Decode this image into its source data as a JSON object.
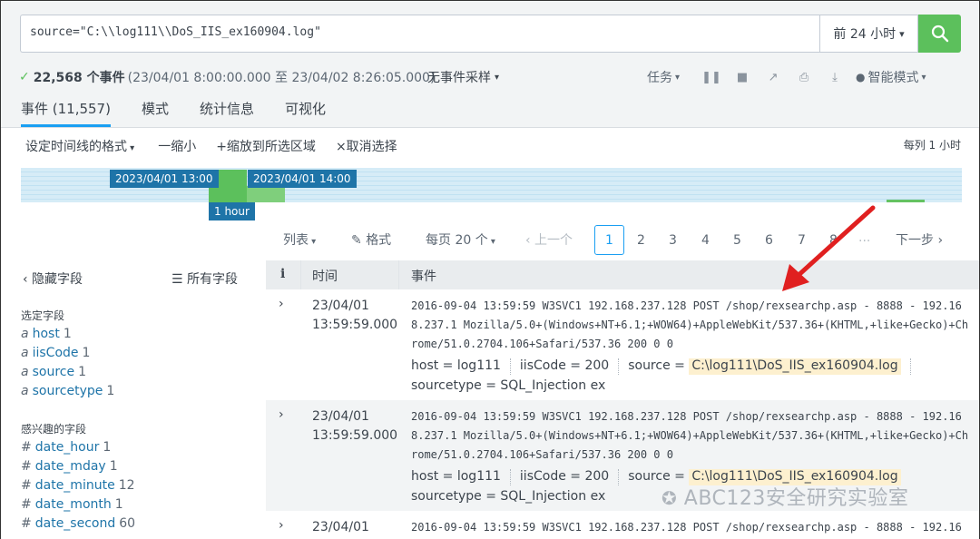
{
  "search": {
    "query": "source=\"C:\\\\log111\\\\DoS_IIS_ex160904.log\"",
    "time_range": "前 24 小时",
    "time_caret": "▾"
  },
  "status": {
    "check": "✓",
    "count": "22,568 个事件",
    "range": "(23/04/01 8:00:00.000 至 23/04/02 8:26:05.000)",
    "sampling": "无事件采样",
    "job": "任务",
    "smart_mode": "智能模式"
  },
  "tabs": [
    {
      "label": "事件 (11,557)"
    },
    {
      "label": "模式"
    },
    {
      "label": "统计信息"
    },
    {
      "label": "可视化"
    }
  ],
  "timeline": {
    "format": "设定时间线的格式",
    "zoom_out": "一缩小",
    "zoom_in": "+缩放到所选区域",
    "deselect": "×取消选择",
    "per_col": "每列 1 小时",
    "tag1": "2023/04/01 13:00",
    "tag2": "2023/04/01 14:00",
    "tag3": "1 hour"
  },
  "pager": {
    "list": "列表",
    "format": "格式",
    "per_page": "每页 20 个",
    "prev": "‹ 上一个",
    "pages": [
      "1",
      "2",
      "3",
      "4",
      "5",
      "6",
      "7",
      "8"
    ],
    "ellipsis": "...",
    "next": "下一步 ›"
  },
  "sidebar": {
    "hide_fields": "‹ 隐藏字段",
    "all_fields": "所有字段",
    "selected_title": "选定字段",
    "selected": [
      {
        "type": "a",
        "name": "host",
        "count": "1"
      },
      {
        "type": "a",
        "name": "iisCode",
        "count": "1"
      },
      {
        "type": "a",
        "name": "source",
        "count": "1"
      },
      {
        "type": "a",
        "name": "sourcetype",
        "count": "1"
      }
    ],
    "interesting_title": "感兴趣的字段",
    "interesting": [
      {
        "type": "#",
        "name": "date_hour",
        "count": "1"
      },
      {
        "type": "#",
        "name": "date_mday",
        "count": "1"
      },
      {
        "type": "#",
        "name": "date_minute",
        "count": "12"
      },
      {
        "type": "#",
        "name": "date_month",
        "count": "1"
      },
      {
        "type": "#",
        "name": "date_second",
        "count": "60"
      }
    ]
  },
  "table": {
    "col_info": "i",
    "col_time": "时间",
    "col_event": "事件",
    "rows": [
      {
        "date": "23/04/01",
        "time": "13:59:59.000",
        "raw": "2016-09-04 13:59:59 W3SVC1 192.168.237.128 POST /shop/rexsearchp.asp - 8888 - 192.168.237.1 Mozilla/5.0+(Windows+NT+6.1;+WOW64)+AppleWebKit/537.36+(KHTML,+like+Gecko)+Chrome/51.0.2704.106+Safari/537.36 200 0 0",
        "host": "host = log111",
        "iis": "iisCode = 200",
        "source_key": "source = ",
        "source_val": "C:\\log111\\DoS_IIS_ex160904.log",
        "sourcetype": "sourcetype = SQL_Injection ex"
      },
      {
        "date": "23/04/01",
        "time": "13:59:59.000",
        "raw": "2016-09-04 13:59:59 W3SVC1 192.168.237.128 POST /shop/rexsearchp.asp - 8888 - 192.168.237.1 Mozilla/5.0+(Windows+NT+6.1;+WOW64)+AppleWebKit/537.36+(KHTML,+like+Gecko)+Chrome/51.0.2704.106+Safari/537.36 200 0 0",
        "host": "host = log111",
        "iis": "iisCode = 200",
        "source_key": "source = ",
        "source_val": "C:\\log111\\DoS_IIS_ex160904.log",
        "sourcetype": "sourcetype = SQL_Injection ex"
      },
      {
        "date": "23/04/01",
        "raw": "2016-09-04 13:59:59 W3SVC1 192.168.237.128 POST /shop/rexsearchp.asp - 8888 - 192.16"
      }
    ]
  },
  "watermark": "ABC123安全研究实验室",
  "colors": {
    "accent": "#1a9ff2",
    "search_button": "#5cc05c",
    "highlight": "#fdf0cf",
    "arrow": "#e02020"
  }
}
